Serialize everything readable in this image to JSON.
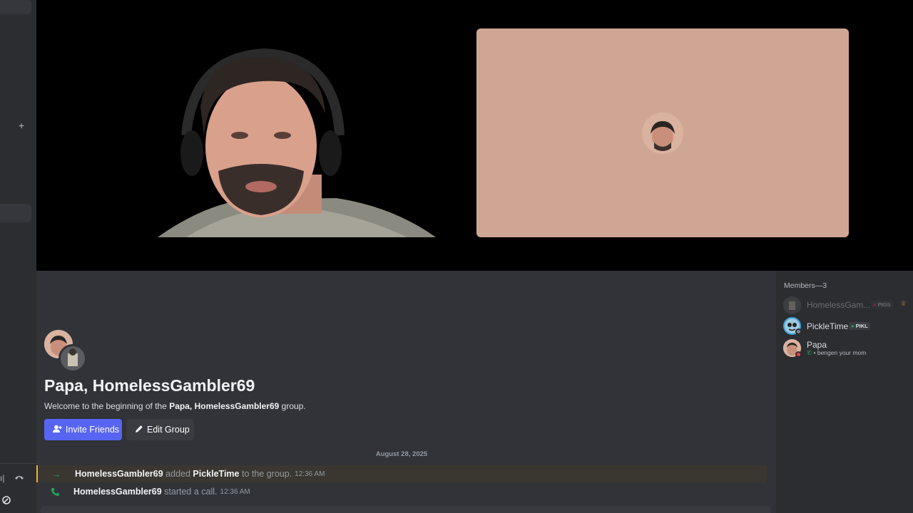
{
  "group": {
    "title": "Papa, HomelessGambler69",
    "welcome_prefix": "Welcome to the beginning of the ",
    "welcome_name": "Papa, HomelessGambler69",
    "welcome_suffix": " group."
  },
  "buttons": {
    "invite": "Invite Friends",
    "edit": "Edit Group"
  },
  "chat": {
    "date_divider": "August 28, 2025",
    "messages": [
      {
        "user": "HomelessGambler69",
        "text1": " added ",
        "target": "PickleTime",
        "text2": " to the group.",
        "time": "12:36 AM"
      },
      {
        "user": "HomelessGambler69",
        "text1": " started a call.",
        "time": "12:36 AM"
      }
    ]
  },
  "members": {
    "header": "Members—3",
    "list": [
      {
        "name": "HomelessGam...",
        "tag": "PIGS",
        "status": ""
      },
      {
        "name": "PickleTime",
        "tag": "PIKL",
        "status": ""
      },
      {
        "name": "Papa",
        "tag": "",
        "status": "• bengen your mom"
      }
    ]
  },
  "icons": {
    "plus": "+",
    "arrow": "→",
    "phone": "✆"
  },
  "colors": {
    "accent": "#5865f2",
    "join_arrow": "#23a55a",
    "avatar_tile": "#cfa693",
    "highlight_border": "#f0b232"
  }
}
